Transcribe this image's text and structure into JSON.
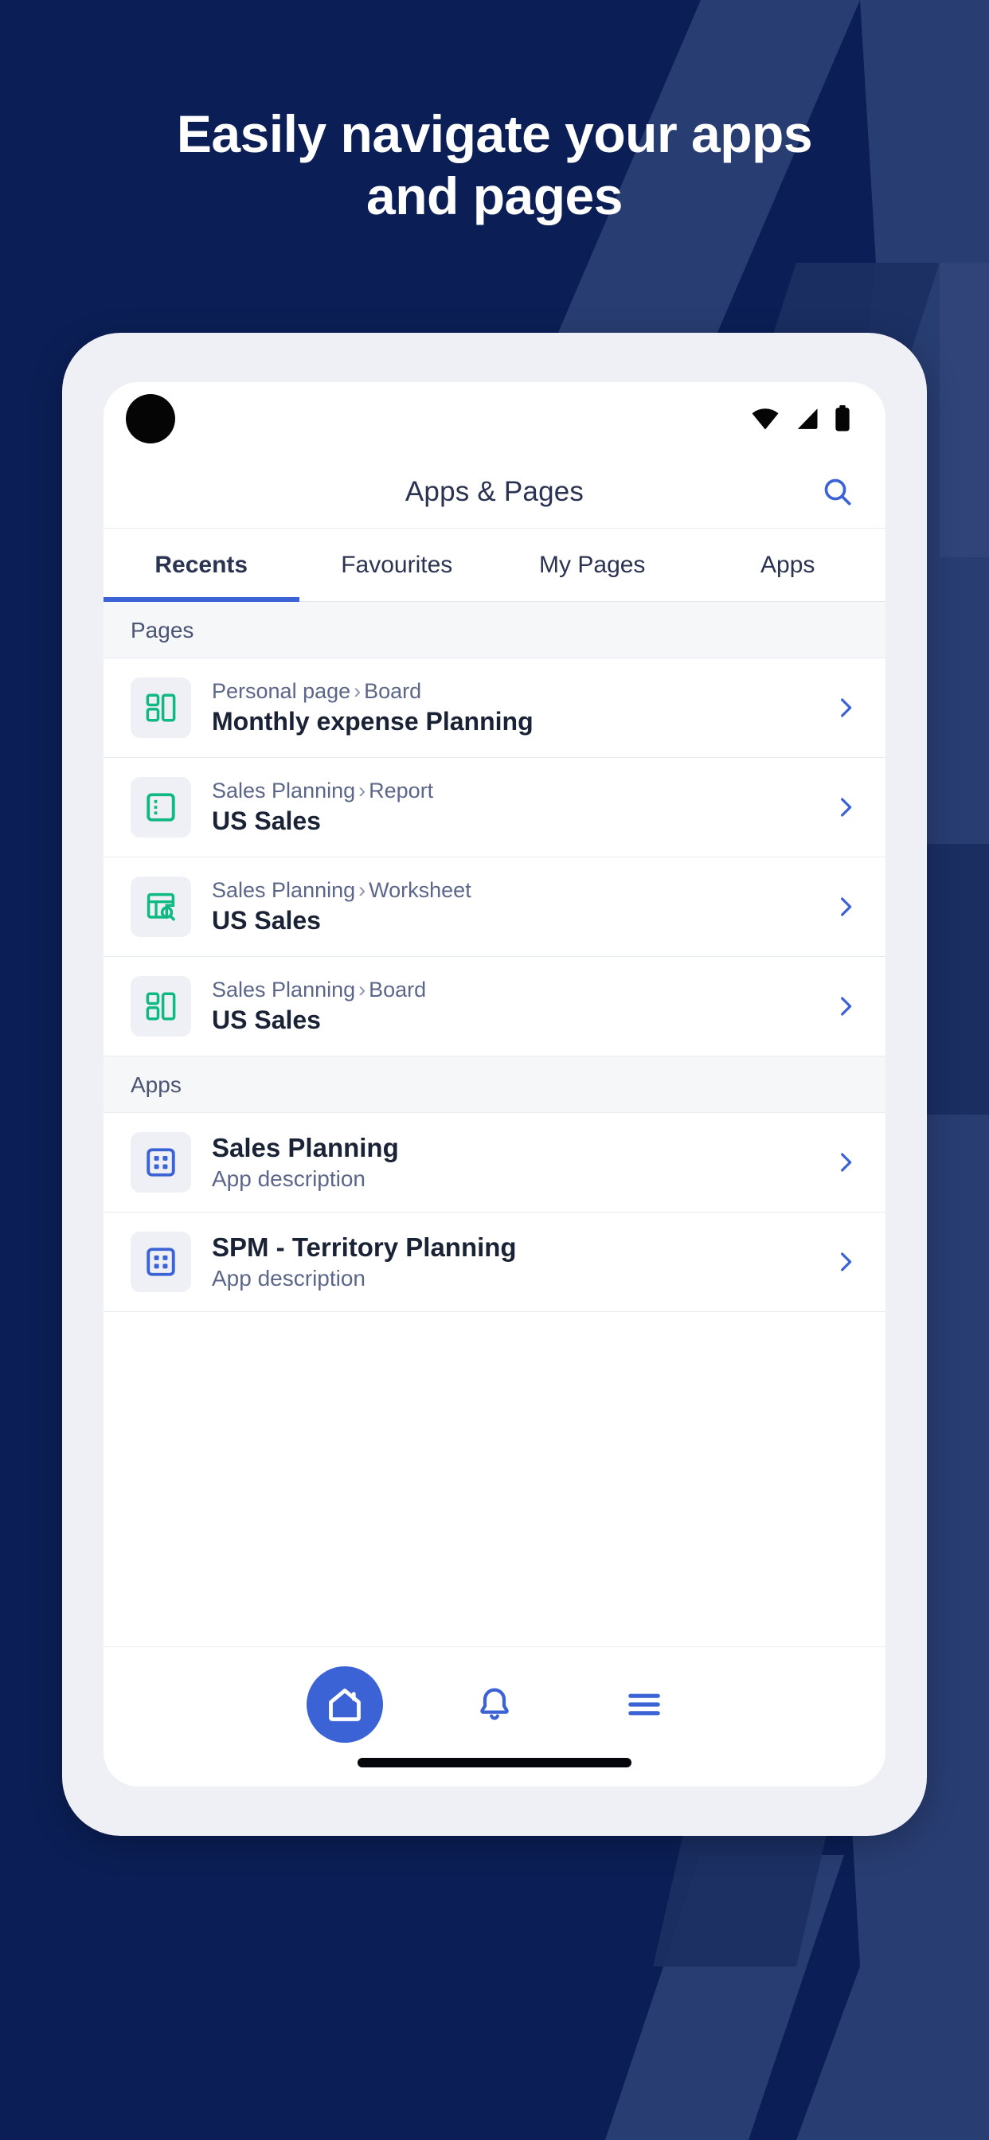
{
  "theme": {
    "background": "#0b1f56",
    "pattern_light": "#2e4377",
    "pattern_dark": "#122category",
    "accent_blue": "#3b63d6",
    "accent_green": "#10b981",
    "text_dark": "#1a2235",
    "text_muted": "#5c6689"
  },
  "headline": {
    "line1": "Easily navigate your apps",
    "line2": "and pages"
  },
  "status_bar": {
    "wifi_icon": "wifi-icon",
    "signal_icon": "cellular-signal-icon",
    "battery_icon": "battery-icon"
  },
  "header": {
    "title": "Apps & Pages",
    "search_icon": "search-icon"
  },
  "tabs": [
    {
      "label": "Recents",
      "active": true
    },
    {
      "label": "Favourites",
      "active": false
    },
    {
      "label": "My Pages",
      "active": false
    },
    {
      "label": "Apps",
      "active": false
    }
  ],
  "sections": [
    {
      "header": "Pages",
      "rows": [
        {
          "icon": "board-icon",
          "breadcrumb_parent": "Personal page",
          "breadcrumb_sep": "›",
          "breadcrumb_type": "Board",
          "title": "Monthly expense Planning"
        },
        {
          "icon": "report-icon",
          "breadcrumb_parent": "Sales Planning",
          "breadcrumb_sep": "›",
          "breadcrumb_type": "Report",
          "title": "US Sales"
        },
        {
          "icon": "worksheet-icon",
          "breadcrumb_parent": "Sales Planning",
          "breadcrumb_sep": "›",
          "breadcrumb_type": "Worksheet",
          "title": "US Sales"
        },
        {
          "icon": "board-icon",
          "breadcrumb_parent": "Sales Planning",
          "breadcrumb_sep": "›",
          "breadcrumb_type": "Board",
          "title": "US Sales"
        }
      ]
    },
    {
      "header": "Apps",
      "rows": [
        {
          "icon": "app-grid-icon",
          "title": "Sales Planning",
          "subtitle": "App description"
        },
        {
          "icon": "app-grid-icon",
          "title": "SPM - Territory Planning",
          "subtitle": "App description"
        }
      ]
    }
  ],
  "bottom_nav": [
    {
      "name": "home",
      "icon": "home-icon",
      "active": true
    },
    {
      "name": "notifications",
      "icon": "bell-icon",
      "active": false
    },
    {
      "name": "menu",
      "icon": "hamburger-menu-icon",
      "active": false
    }
  ]
}
